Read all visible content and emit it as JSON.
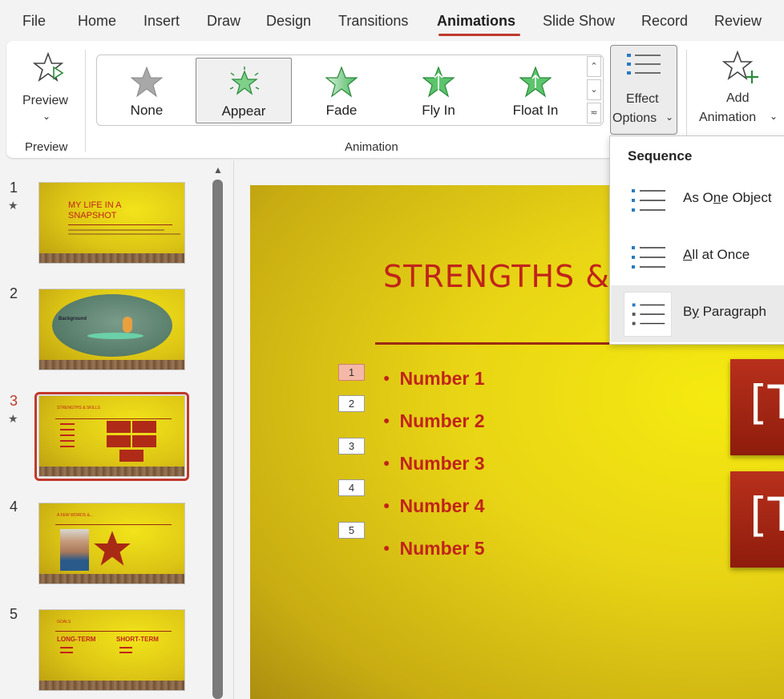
{
  "menu": {
    "tabs": [
      {
        "label": "File"
      },
      {
        "label": "Home"
      },
      {
        "label": "Insert"
      },
      {
        "label": "Draw"
      },
      {
        "label": "Design"
      },
      {
        "label": "Transitions"
      },
      {
        "label": "Animations"
      },
      {
        "label": "Slide Show"
      },
      {
        "label": "Record"
      },
      {
        "label": "Review"
      }
    ],
    "active_tab": "Animations"
  },
  "ribbon": {
    "preview": {
      "label": "Preview",
      "group_label": "Preview"
    },
    "animation_group_label": "Animation",
    "gallery": [
      {
        "label": "None",
        "icon": "gray-star-icon"
      },
      {
        "label": "Appear",
        "icon": "appear-star-icon",
        "selected": true
      },
      {
        "label": "Fade",
        "icon": "fade-star-icon"
      },
      {
        "label": "Fly In",
        "icon": "fly-in-star-icon"
      },
      {
        "label": "Float In",
        "icon": "float-in-star-icon"
      }
    ],
    "effect_options": {
      "line1": "Effect",
      "line2": "Options"
    },
    "add_animation": {
      "line1": "Add",
      "line2": "Animation"
    }
  },
  "dropdown": {
    "header": "Sequence",
    "items": [
      {
        "label": "As One Object",
        "pre": "As O",
        "u": "n",
        "post": "e Object"
      },
      {
        "label": "All at Once",
        "pre": "",
        "u": "A",
        "post": "ll at Once"
      },
      {
        "label": "By Paragraph",
        "pre": "B",
        "u": "y",
        "post": " Paragraph",
        "hover": true
      }
    ]
  },
  "slides_panel": {
    "slides": [
      {
        "number": "1",
        "has_animation": true,
        "title": "MY LIFE IN A SNAPSHOT"
      },
      {
        "number": "2",
        "has_animation": false,
        "title": "Background"
      },
      {
        "number": "3",
        "has_animation": true,
        "title": "STRENGTHS & SKILLS",
        "selected": true
      },
      {
        "number": "4",
        "has_animation": false,
        "title": "A FEW WORDS &..."
      },
      {
        "number": "5",
        "has_animation": false,
        "title": "GOALS",
        "columns": [
          "LONG-TERM",
          "SHORT-TERM"
        ]
      }
    ],
    "star_glyph": "★"
  },
  "current_slide": {
    "title": "STRENGTHS &",
    "bullets": [
      "Number 1",
      "Number 2",
      "Number 3",
      "Number 4",
      "Number 5"
    ],
    "animation_tags": [
      "1",
      "2",
      "3",
      "4",
      "5"
    ],
    "box_text": "[T"
  },
  "colors": {
    "accent": "#c0392b",
    "slide_title": "#c0241a",
    "slide_bg": "#e8d415"
  }
}
